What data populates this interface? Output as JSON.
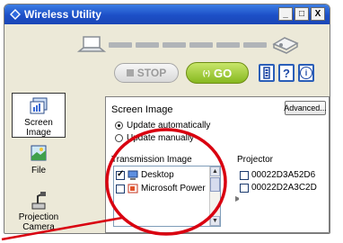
{
  "window": {
    "title": "Wireless Utility",
    "controls": {
      "minimize": "_",
      "maximize": "□",
      "close": "X"
    }
  },
  "toolbar": {
    "stop_label": "STOP",
    "go_label": "GO",
    "go_icon": "(•)",
    "help_label": "?",
    "info_label": "i",
    "battery_icon": "battery-icon"
  },
  "sidebar": {
    "items": [
      {
        "label": "Screen Image",
        "icon": "screen-image-icon",
        "selected": true
      },
      {
        "label": "File",
        "icon": "file-icon",
        "selected": false
      },
      {
        "label": "Projection Camera",
        "icon": "projection-camera-icon",
        "selected": false
      }
    ]
  },
  "panel": {
    "title": "Screen Image",
    "advanced_label": "Advanced...",
    "update_auto_label": "Update automatically",
    "update_manual_label": "Update manually",
    "transmission_label": "Transmission Image",
    "projector_label": "Projector",
    "transmission_items": [
      {
        "label": "Desktop",
        "checked": true,
        "icon": "desktop-icon"
      },
      {
        "label": "Microsoft Power",
        "checked": false,
        "icon": "powerpoint-icon"
      }
    ],
    "projector_items": [
      {
        "label": "00022D3A52D6",
        "checked": false
      },
      {
        "label": "00022D2A3C2D",
        "checked": false
      }
    ]
  },
  "colors": {
    "title_bar": "#1c4fc7",
    "go_button": "#86b820",
    "highlight_circle": "#d90010",
    "accent_blue": "#2a5eb8"
  }
}
